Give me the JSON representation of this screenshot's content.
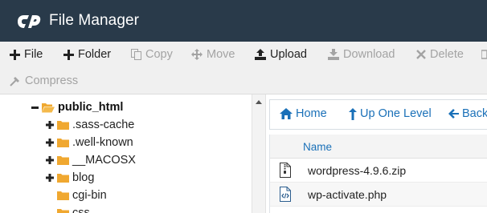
{
  "header": {
    "app_title": "File Manager",
    "logo_icon": "cpanel-logo-icon",
    "background": "#293a4a"
  },
  "toolbar": {
    "row1": [
      {
        "label": "File",
        "icon": "plus-icon",
        "enabled": true
      },
      {
        "label": "Folder",
        "icon": "plus-icon",
        "enabled": true
      },
      {
        "label": "Copy",
        "icon": "copy-icon",
        "enabled": false
      },
      {
        "label": "Move",
        "icon": "move-arrows-icon",
        "enabled": false
      },
      {
        "label": "Upload",
        "icon": "upload-icon",
        "enabled": true
      },
      {
        "label": "Download",
        "icon": "download-icon",
        "enabled": false
      },
      {
        "label": "Delete",
        "icon": "x-icon",
        "enabled": false
      }
    ],
    "row2": [
      {
        "label": "Compress",
        "icon": "compress-icon",
        "enabled": false
      }
    ]
  },
  "tree": {
    "items": [
      {
        "label": "public_html",
        "expander": "minus",
        "bold": true,
        "open": true
      },
      {
        "label": ".sass-cache",
        "expander": "plus"
      },
      {
        "label": ".well-known",
        "expander": "plus"
      },
      {
        "label": "__MACOSX",
        "expander": "plus"
      },
      {
        "label": "blog",
        "expander": "plus"
      },
      {
        "label": "cgi-bin",
        "expander": "none"
      },
      {
        "label": "css",
        "expander": "none"
      }
    ]
  },
  "nav": {
    "home": "Home",
    "up": "Up One Level",
    "back": "Back"
  },
  "file_list": {
    "column_name": "Name",
    "files": [
      {
        "name": "wordpress-4.9.6.zip",
        "icon": "zip-file-icon"
      },
      {
        "name": "wp-activate.php",
        "icon": "code-file-icon"
      }
    ]
  },
  "colors": {
    "link": "#1a70b8",
    "folder": "#f0a830",
    "disabled": "#a3a3a3"
  }
}
